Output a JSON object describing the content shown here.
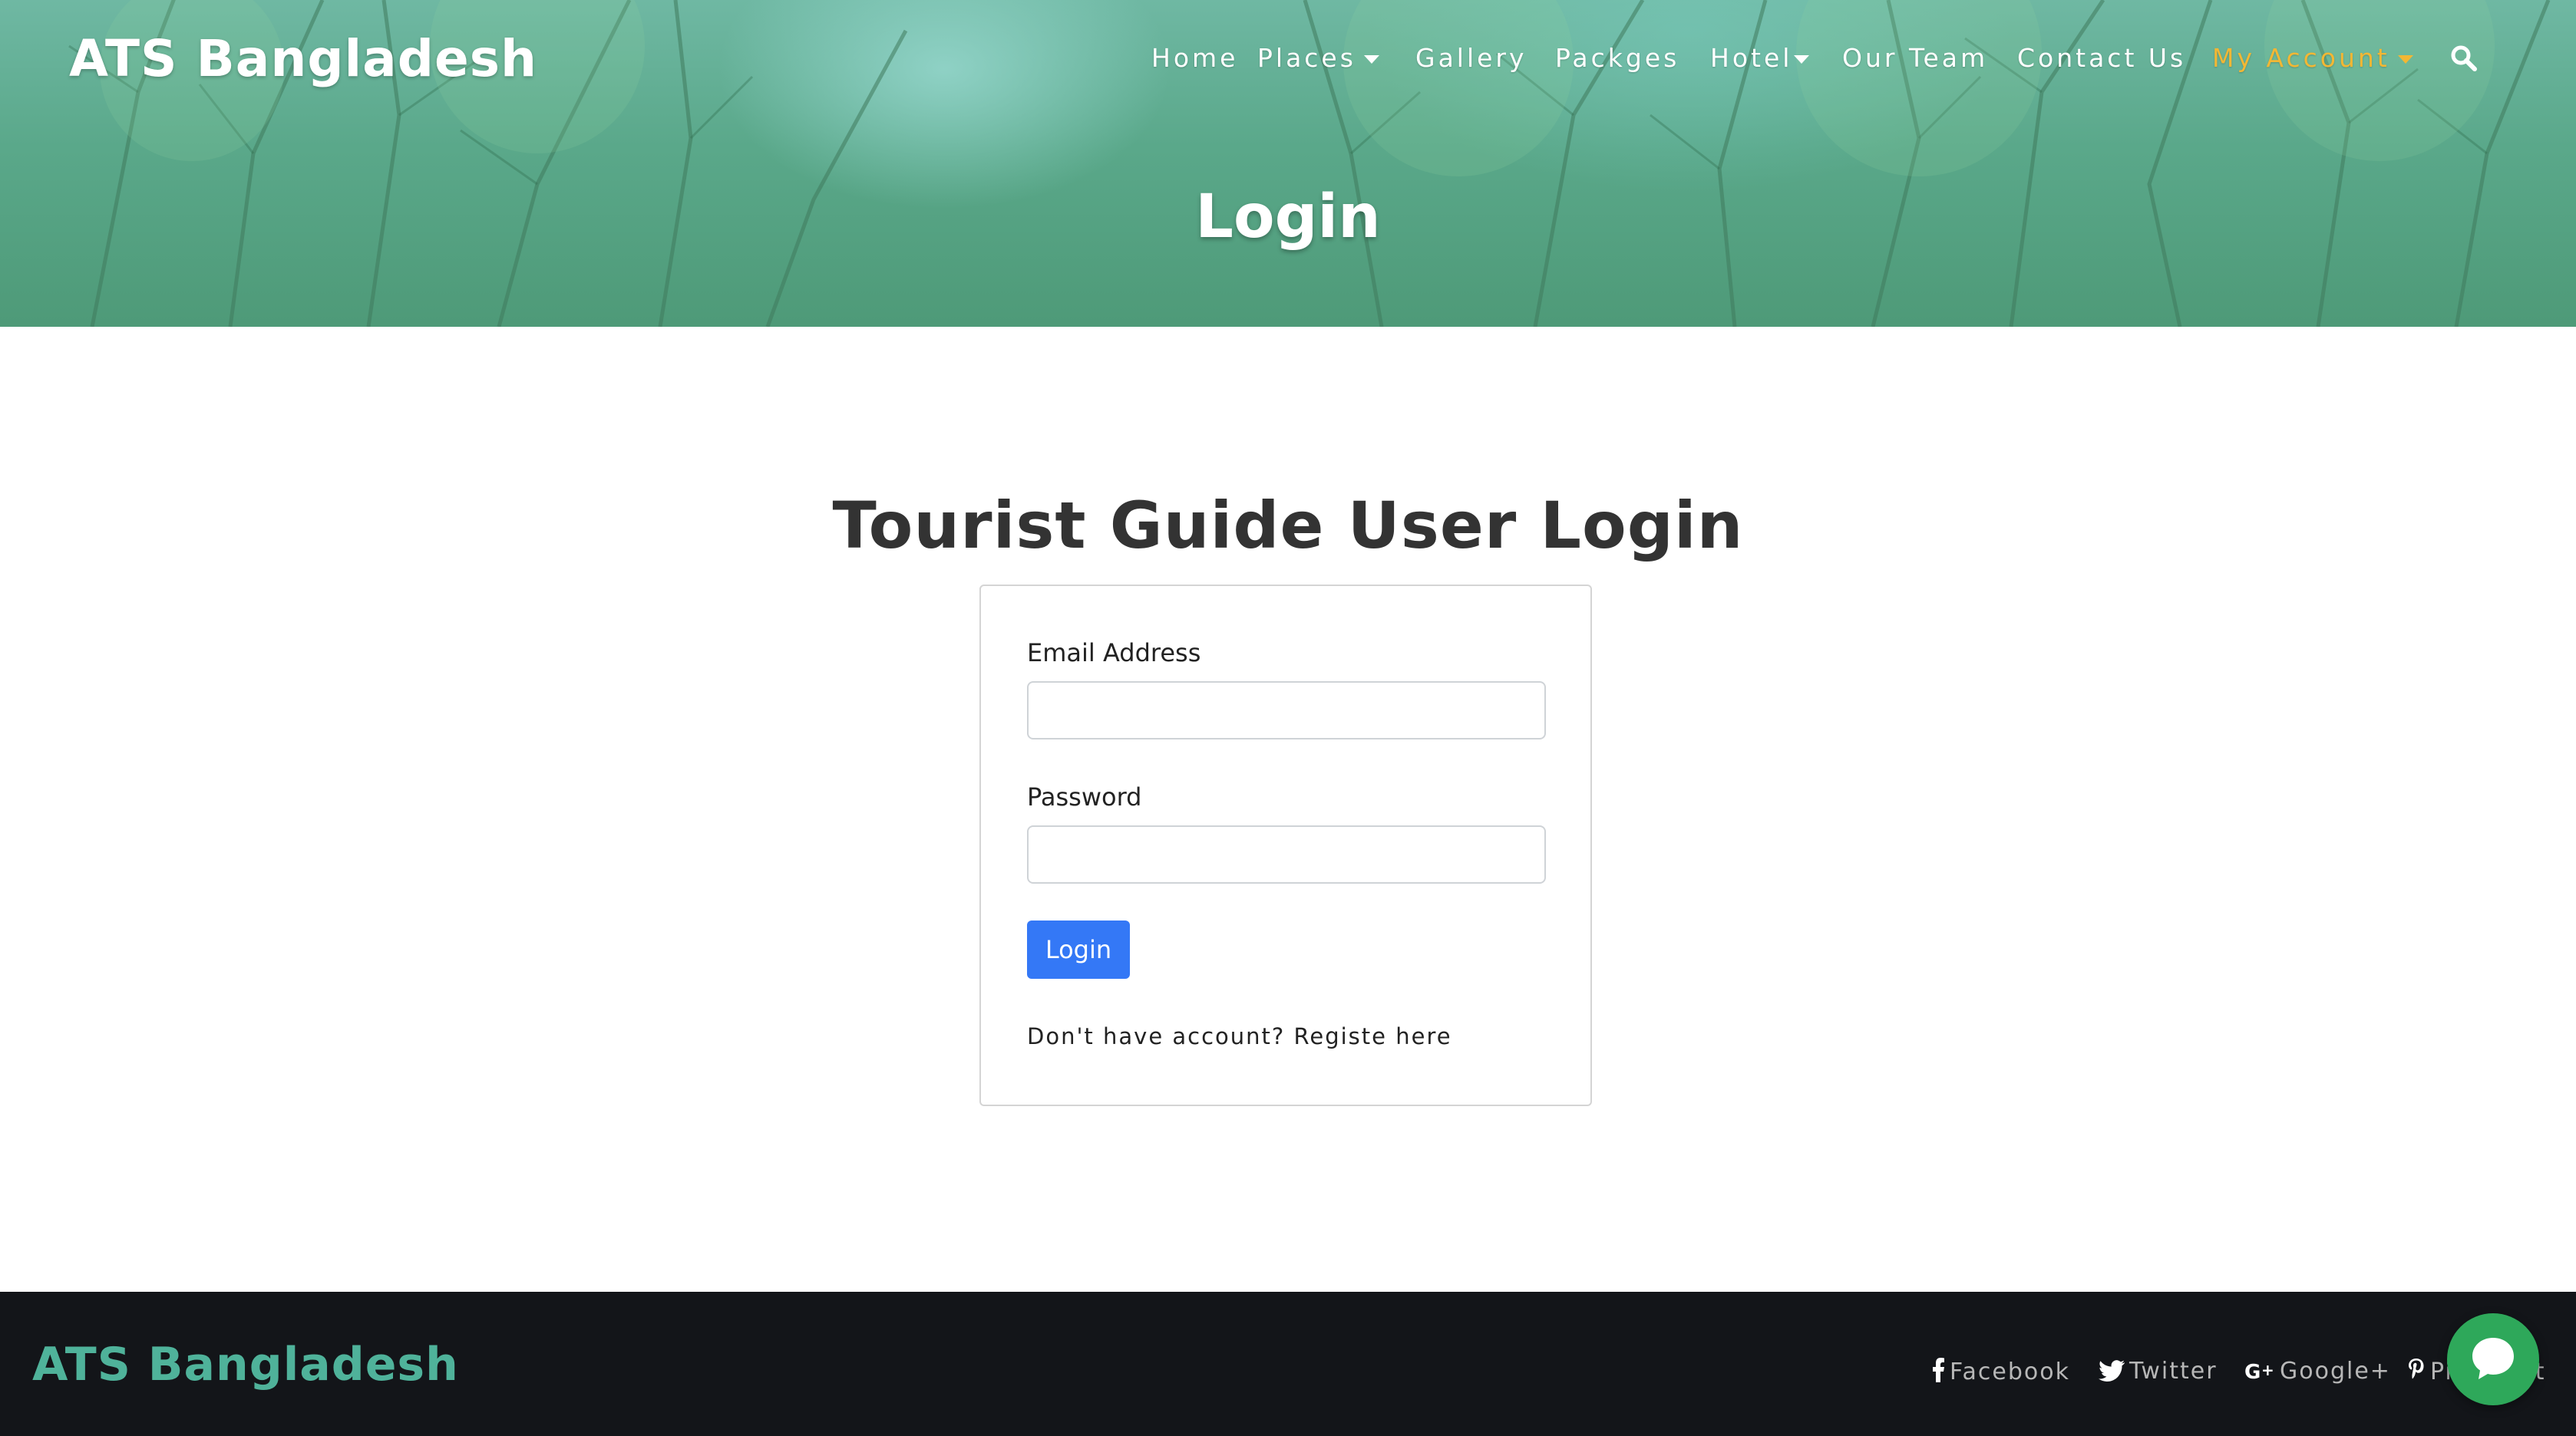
{
  "header": {
    "brand": "ATS Bangladesh",
    "nav": [
      {
        "label": "Home"
      },
      {
        "label": "Places"
      },
      {
        "label": "Gallery"
      },
      {
        "label": "Packges"
      },
      {
        "label": "Hotel"
      },
      {
        "label": "Our Team"
      },
      {
        "label": "Contact Us"
      },
      {
        "label": "My Account"
      }
    ],
    "hero_title": "Login"
  },
  "main": {
    "heading": "Tourist Guide User Login",
    "form": {
      "email_label": "Email Address",
      "email_value": "",
      "password_label": "Password",
      "password_value": "",
      "submit_label": "Login",
      "register_prompt": "Don't have account?",
      "register_link": "Registe here"
    }
  },
  "footer": {
    "brand": "ATS Bangladesh",
    "social": [
      {
        "label": "Facebook",
        "icon": "facebook-icon"
      },
      {
        "label": "Twitter",
        "icon": "twitter-icon"
      },
      {
        "label": "Google+",
        "icon": "google-plus-icon"
      },
      {
        "label": "Pinterest",
        "icon": "pinterest-icon"
      }
    ]
  },
  "colors": {
    "accent_nav_active": "#f2b734",
    "button_primary": "#3478f6",
    "footer_bg": "#131519",
    "footer_brand": "#4fb29a",
    "chat_button": "#2ea85a"
  }
}
